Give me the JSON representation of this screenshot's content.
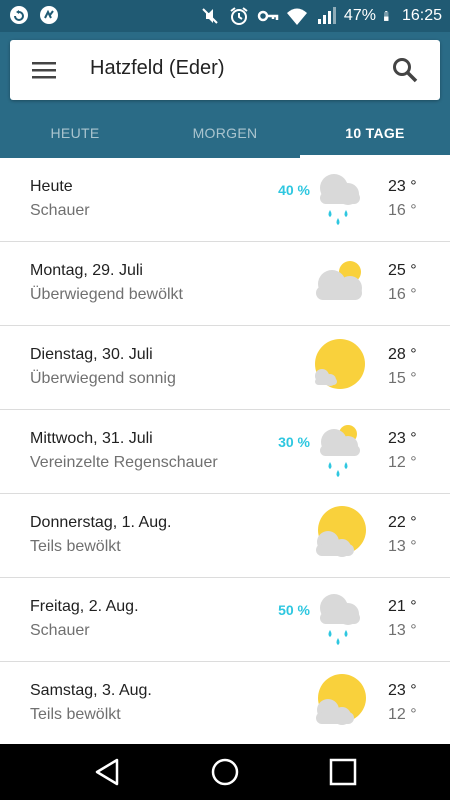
{
  "status_bar": {
    "battery": "47%",
    "time": "16:25",
    "icons": [
      "notification-icon",
      "notification-icon-2",
      "mute-icon",
      "alarm-icon",
      "vpn-key-icon",
      "wifi-icon",
      "signal-icon",
      "battery-icon"
    ]
  },
  "header": {
    "location": "Hatzfeld (Eder)",
    "tabs": [
      {
        "label": "HEUTE",
        "active": false
      },
      {
        "label": "MORGEN",
        "active": false
      },
      {
        "label": "10 TAGE",
        "active": true
      }
    ]
  },
  "forecast": [
    {
      "day": "Heute",
      "condition": "Schauer",
      "precip": "40 %",
      "icon": "rain-cloud-icon",
      "high": "23 °",
      "low": "16 °"
    },
    {
      "day": "Montag, 29. Juli",
      "condition": "Überwiegend bewölkt",
      "precip": "",
      "icon": "mostly-cloudy-icon",
      "high": "25 °",
      "low": "16 °"
    },
    {
      "day": "Dienstag, 30. Juli",
      "condition": "Überwiegend sonnig",
      "precip": "",
      "icon": "mostly-sunny-icon",
      "high": "28 °",
      "low": "15 °"
    },
    {
      "day": "Mittwoch, 31. Juli",
      "condition": "Vereinzelte Regenschauer",
      "precip": "30 %",
      "icon": "scattered-showers-icon",
      "high": "23 °",
      "low": "12 °"
    },
    {
      "day": "Donnerstag, 1. Aug.",
      "condition": "Teils bewölkt",
      "precip": "",
      "icon": "partly-cloudy-icon",
      "high": "22 °",
      "low": "13 °"
    },
    {
      "day": "Freitag, 2. Aug.",
      "condition": "Schauer",
      "precip": "50 %",
      "icon": "rain-cloud-icon",
      "high": "21 °",
      "low": "13 °"
    },
    {
      "day": "Samstag, 3. Aug.",
      "condition": "Teils bewölkt",
      "precip": "",
      "icon": "partly-cloudy-icon",
      "high": "23 °",
      "low": "12 °"
    }
  ],
  "colors": {
    "header_bg": "#2a6b86",
    "status_bg": "#205a73",
    "precip": "#2ec7e0",
    "sun": "#f9d13c",
    "cloud": "#d9d9d9",
    "rain": "#2ec7e0"
  },
  "nav": {
    "icons": [
      "back-icon",
      "home-icon",
      "recents-icon"
    ]
  }
}
